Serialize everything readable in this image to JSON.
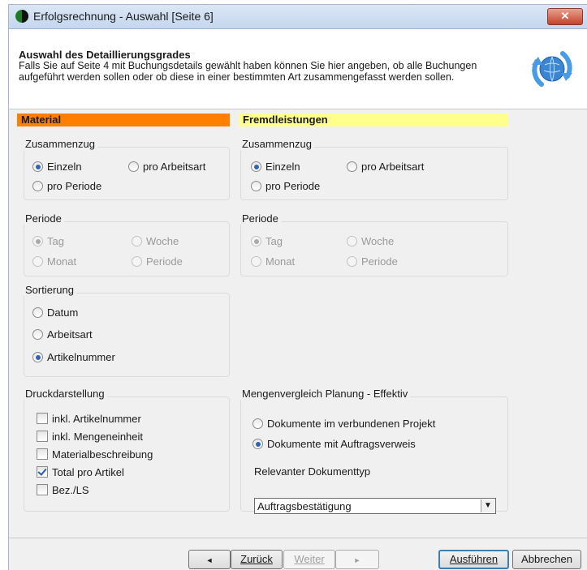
{
  "window": {
    "title": "Erfolgsrechnung - Auswahl [Seite 6]",
    "close_label": "✕"
  },
  "header": {
    "title": "Auswahl des Detaillierungsgrades",
    "description": "Falls Sie auf Seite 4 mit Buchungsdetails gewählt haben können Sie hier angeben, ob alle Buchungen aufgeführt werden sollen oder ob diese in einer bestimmten Art zusammengefasst werden sollen."
  },
  "colors": {
    "material": "#ff7f00",
    "fremdleistungen": "#ffff8c",
    "accent": "#2f63b6"
  },
  "material": {
    "heading": "Material",
    "zusammenzug": {
      "title": "Zusammenzug",
      "options": [
        "Einzeln",
        "pro Arbeitsart",
        "pro Periode"
      ],
      "selected": "Einzeln"
    },
    "periode": {
      "title": "Periode",
      "options": [
        "Tag",
        "Woche",
        "Monat",
        "Periode"
      ],
      "selected": "Tag",
      "enabled": false
    },
    "sortierung": {
      "title": "Sortierung",
      "options": [
        "Datum",
        "Arbeitsart",
        "Artikelnummer"
      ],
      "selected": "Artikelnummer"
    },
    "druckdarstellung": {
      "title": "Druckdarstellung",
      "items": [
        {
          "label": "inkl. Artikelnummer",
          "checked": false
        },
        {
          "label": "inkl. Mengeneinheit",
          "checked": false
        },
        {
          "label": "Materialbeschreibung",
          "checked": false
        },
        {
          "label": "Total pro Artikel",
          "checked": true
        },
        {
          "label": "Bez./LS",
          "checked": false
        }
      ]
    }
  },
  "fremdleistungen": {
    "heading": "Fremdleistungen",
    "zusammenzug": {
      "title": "Zusammenzug",
      "options": [
        "Einzeln",
        "pro Arbeitsart",
        "pro Periode"
      ],
      "selected": "Einzeln"
    },
    "periode": {
      "title": "Periode",
      "options": [
        "Tag",
        "Woche",
        "Monat",
        "Periode"
      ],
      "selected": "Tag",
      "enabled": false
    }
  },
  "mengenvergleich": {
    "title": "Mengenvergleich Planung - Effektiv",
    "options": [
      "Dokumente im verbundenen Projekt",
      "Dokumente mit Auftragsverweis"
    ],
    "selected": "Dokumente mit Auftragsverweis",
    "doktyp_label": "Relevanter Dokumenttyp",
    "doktyp_value": "Auftragsbestätigung"
  },
  "footer": {
    "back_arrow": "◄",
    "zurueck": "Zurück",
    "weiter": "Weiter",
    "next_arrow": "►",
    "ausfuehren": "Ausführen",
    "abbrechen": "Abbrechen"
  }
}
